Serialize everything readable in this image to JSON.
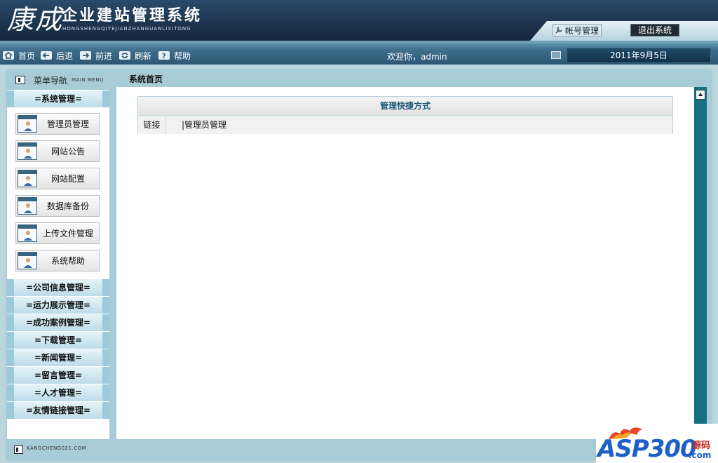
{
  "header": {
    "logo_cn": "康成",
    "title": "企业建站管理系统",
    "subtitle": "HONGSHENGQIYEJIANZHANGUANLIXITONG",
    "account_label": "帐号管理",
    "logout_label": "退出系统"
  },
  "toolbar": {
    "items": [
      {
        "label": "首页",
        "icon": "home-icon"
      },
      {
        "label": "后退",
        "icon": "back-arrow-icon"
      },
      {
        "label": "前进",
        "icon": "forward-arrow-icon"
      },
      {
        "label": "刷新",
        "icon": "refresh-icon"
      },
      {
        "label": "帮助",
        "icon": "help-icon"
      }
    ],
    "welcome": "欢迎你，admin",
    "date": "2011年9月5日"
  },
  "sidebar": {
    "title": "菜单导航",
    "title_en": "MAIN MENU",
    "groups": [
      {
        "label": "=系统管理=",
        "items": [
          "管理员管理",
          "网站公告",
          "网站配置",
          "数据库备份",
          "上传文件管理",
          "系统帮助"
        ]
      },
      {
        "label": "=公司信息管理="
      },
      {
        "label": "=运力展示管理="
      },
      {
        "label": "=成功案例管理="
      },
      {
        "label": "=下载管理="
      },
      {
        "label": "=新闻管理="
      },
      {
        "label": "=留言管理="
      },
      {
        "label": "=人才管理="
      },
      {
        "label": "=友情链接管理="
      }
    ]
  },
  "main": {
    "breadcrumb": "系统首页",
    "panel_title": "管理快捷方式",
    "row_label": "链接",
    "row_link": "|管理员管理"
  },
  "footer": {
    "text": "KANGCHENG021.COM"
  },
  "watermark": {
    "brand": "ASP300",
    "suffix": "源码",
    "domain": ".com"
  }
}
